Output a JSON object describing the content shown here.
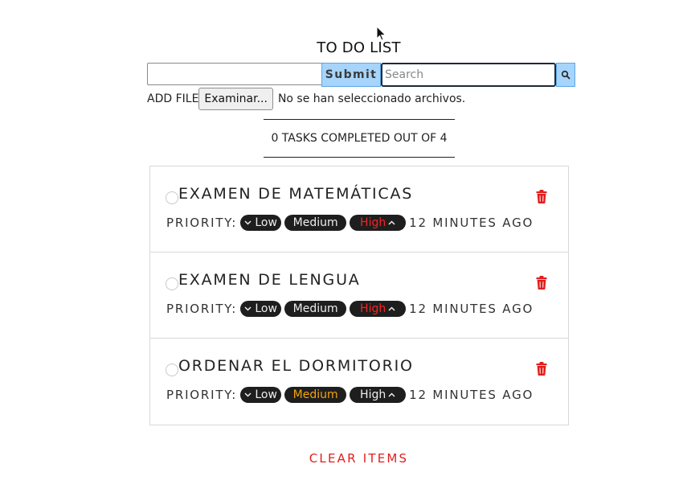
{
  "header": {
    "title": "TO DO LIST"
  },
  "form": {
    "task_value": "",
    "submit_label": "Submit",
    "search_placeholder": "Search",
    "file_label": "ADD FILE",
    "file_button_label": "Examinar...",
    "file_status": "No se han seleccionado archivos."
  },
  "status": {
    "text": "0 TASKS COMPLETED OUT OF 4"
  },
  "tasks": [
    {
      "title": "EXAMEN DE MATEMÁTICAS",
      "priority_label": "PRIORITY:",
      "low_label": "Low",
      "medium_label": "Medium",
      "high_label": "High",
      "selected_priority": "High",
      "time": "12 MINUTES AGO"
    },
    {
      "title": "EXAMEN DE LENGUA",
      "priority_label": "PRIORITY:",
      "low_label": "Low",
      "medium_label": "Medium",
      "high_label": "High",
      "selected_priority": "High",
      "time": "12 MINUTES AGO"
    },
    {
      "title": "ORDENAR EL DORMITORIO",
      "priority_label": "PRIORITY:",
      "low_label": "Low",
      "medium_label": "Medium",
      "high_label": "High",
      "selected_priority": "Medium",
      "time": "12 MINUTES AGO"
    }
  ],
  "footer": {
    "clear_label": "CLEAR ITEMS"
  },
  "colors": {
    "accent_blue": "#a6d4fa",
    "high_priority": "#ff2020",
    "medium_priority": "#f3a30c",
    "danger": "#e21d1d",
    "pill_bg": "#1e1e1e"
  },
  "icons": {
    "search": "search-icon",
    "delete": "trash-icon",
    "chevron_down": "chevron-down-icon",
    "chevron_up": "chevron-up-icon",
    "cursor": "mouse-cursor-icon"
  }
}
